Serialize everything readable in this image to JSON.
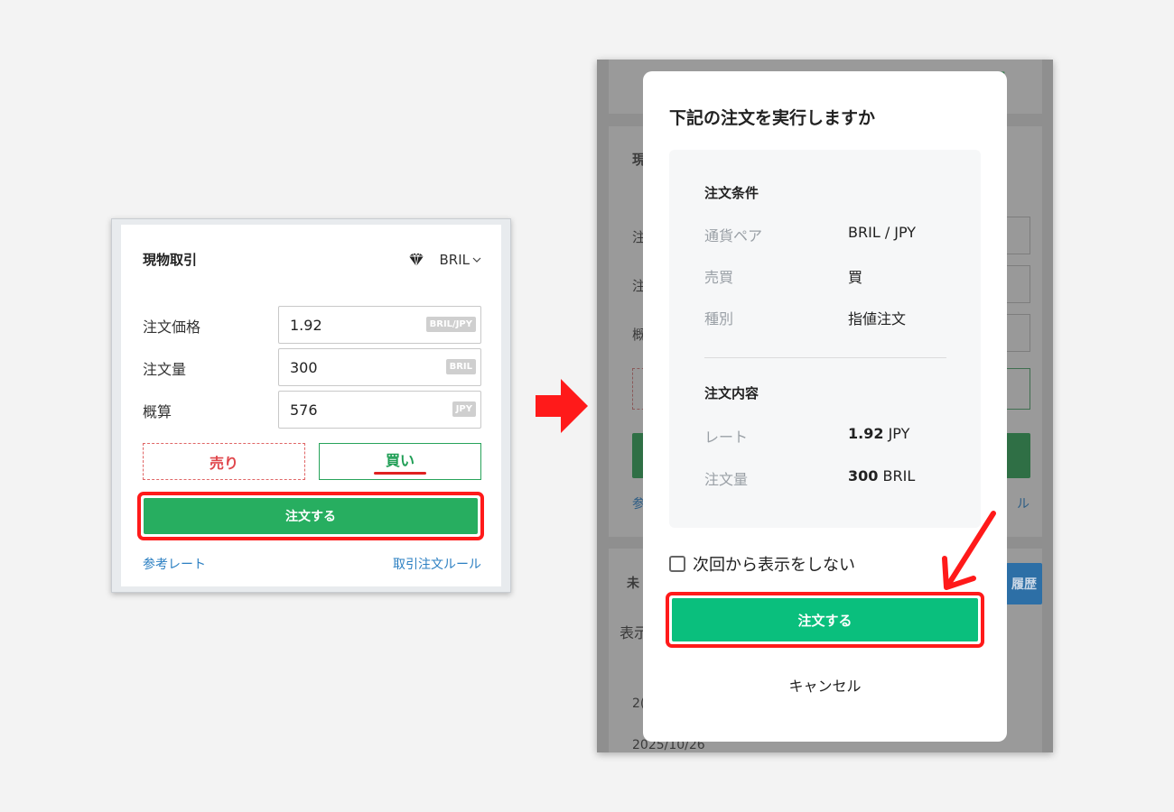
{
  "left_panel": {
    "title": "現物取引",
    "pair": "BRIL",
    "rows": [
      {
        "label": "注文価格",
        "value": "1.92",
        "unit": "BRIL/JPY"
      },
      {
        "label": "注文量",
        "value": "300",
        "unit": "BRIL"
      },
      {
        "label": "概算",
        "value": "576",
        "unit": "JPY"
      }
    ],
    "sell_label": "売り",
    "buy_label": "買い",
    "order_label": "注文する",
    "reference_rate_link": "参考レート",
    "trading_rules_link": "取引注文ルール"
  },
  "background": {
    "date_text": "2025/10/26",
    "partial_texts": [
      "現",
      "注",
      "注",
      "概",
      "参",
      "ル",
      "未",
      "表示",
      "2(",
      "履歴",
      "25"
    ]
  },
  "modal": {
    "title": "下記の注文を実行しますか",
    "conditions_heading": "注文条件",
    "conditions": [
      {
        "key": "通貨ペア",
        "value": "BRIL / JPY"
      },
      {
        "key": "売買",
        "value": "買"
      },
      {
        "key": "種別",
        "value": "指値注文"
      }
    ],
    "details_heading": "注文内容",
    "details": [
      {
        "key": "レート",
        "value_bold": "1.92",
        "value_unit": "JPY"
      },
      {
        "key": "注文量",
        "value_bold": "300",
        "value_unit": "BRIL"
      }
    ],
    "dont_show_label": "次回から表示をしない",
    "order_label": "注文する",
    "cancel_label": "キャンセル"
  },
  "colors": {
    "buy_green": "#27ae60",
    "modal_green": "#0abf7d",
    "sell_red": "#e0474c",
    "highlight_red": "#ff1a1a",
    "link_blue": "#2b7fc2"
  }
}
